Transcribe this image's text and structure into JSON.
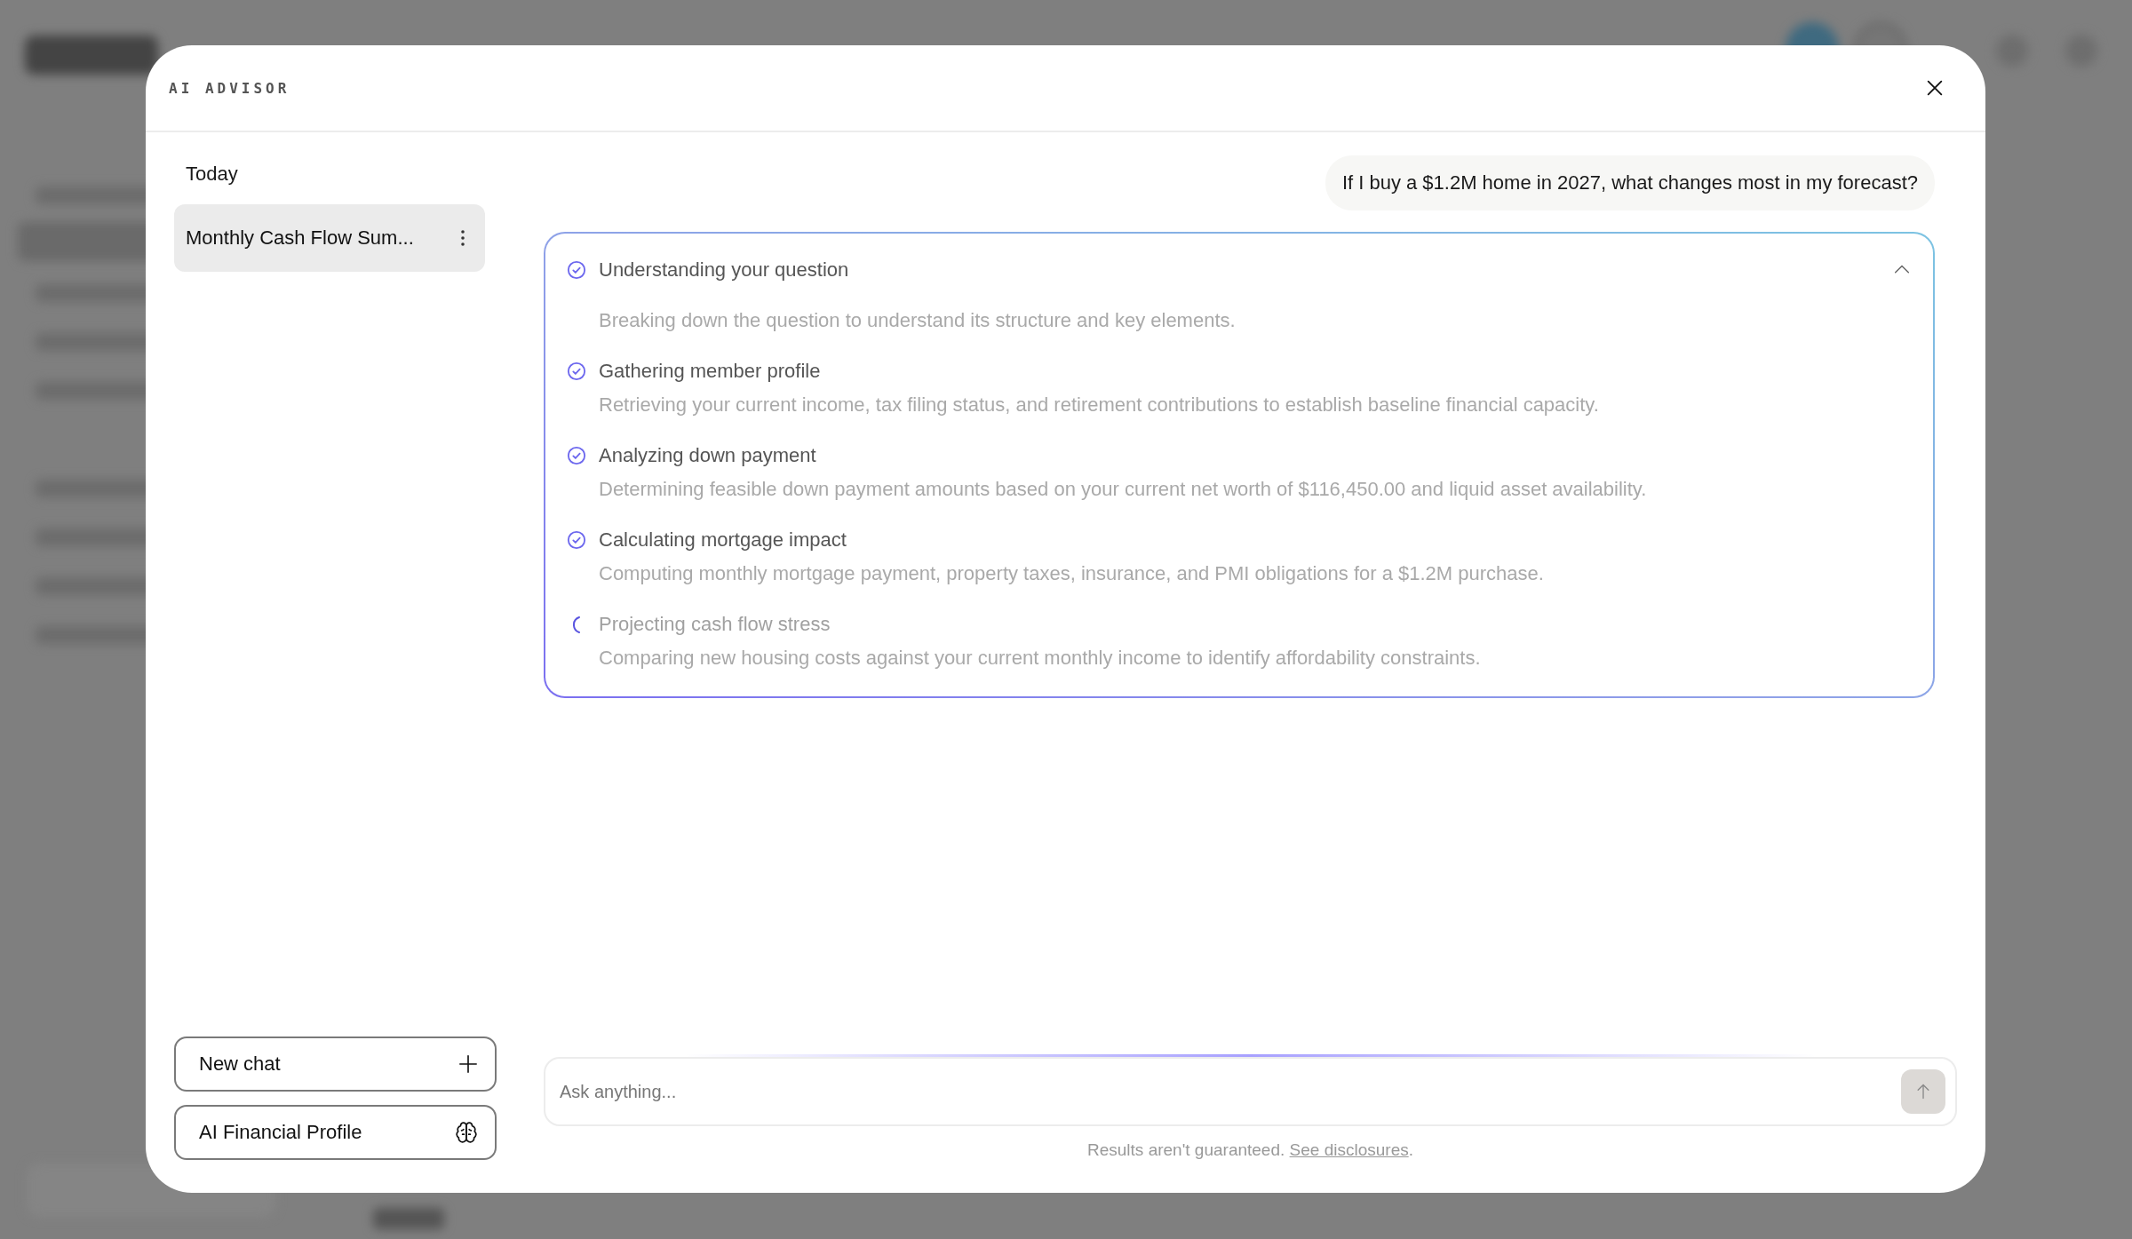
{
  "dialog": {
    "title": "AI ADVISOR"
  },
  "sidebar": {
    "section_label": "Today",
    "chats": [
      {
        "title": "Monthly Cash Flow Sum...",
        "selected": true
      }
    ],
    "buttons": [
      {
        "label": "New chat",
        "kind": "new"
      },
      {
        "label": "AI Financial Profile",
        "kind": "profile"
      }
    ]
  },
  "chat": {
    "user_message": "If I buy a $1.2M home in 2027, what changes most in my forecast?",
    "steps": {
      "expanded": true,
      "items": [
        {
          "title": "Understanding your question",
          "description": "Breaking down the question to understand its structure and key elements.",
          "completed": true
        },
        {
          "title": "Gathering member profile",
          "description": "Retrieving your current income, tax filing status, and retirement contributions to establish baseline financial capacity.",
          "completed": true
        },
        {
          "title": "Analyzing down payment",
          "description": "Determining feasible down payment amounts based on your current net worth of $116,450.00 and liquid asset availability.",
          "completed": true
        },
        {
          "title": "Calculating mortgage impact",
          "description": "Computing monthly mortgage payment, property taxes, insurance, and PMI obligations for a $1.2M purchase.",
          "completed": true
        },
        {
          "title": "Projecting cash flow stress",
          "description": "Comparing new housing costs against your current monthly income to identify affordability constraints.",
          "completed": false
        }
      ]
    }
  },
  "composer": {
    "placeholder": "Ask anything..."
  },
  "disclaimer": {
    "text": "Results aren't guaranteed.",
    "link": "See disclosures",
    "end": "."
  }
}
